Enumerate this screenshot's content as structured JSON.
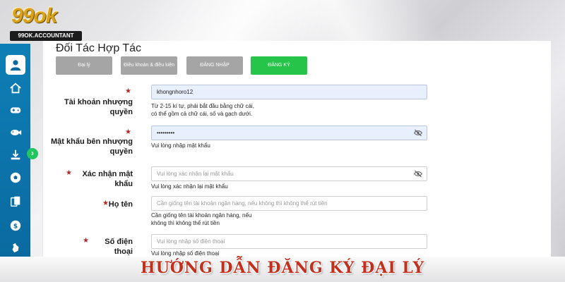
{
  "logo": {
    "number": "99ok",
    "domain": "99OK.ACCOUNTANT"
  },
  "sidebar": {
    "items": [
      {
        "icon": "user-icon",
        "active": true
      },
      {
        "icon": "home-icon"
      },
      {
        "icon": "gamepad-icon"
      },
      {
        "icon": "fish-icon"
      },
      {
        "icon": "download-icon"
      },
      {
        "icon": "soccer-ball-icon"
      },
      {
        "icon": "cards-icon"
      },
      {
        "icon": "coin-icon"
      },
      {
        "icon": "cock-icon"
      }
    ],
    "toggle": "›"
  },
  "page_title": "Đối Tác Hợp Tác",
  "tabs": [
    {
      "label": "Đại lý",
      "active": false
    },
    {
      "label": "Điều khoản & điều kiện",
      "active": false
    },
    {
      "label": "ĐĂNG NHẬP",
      "active": false
    },
    {
      "label": "ĐĂNG KÝ",
      "active": true
    }
  ],
  "form": {
    "account": {
      "label_line1": "Tài khoản nhượng",
      "label_line2": "quyền",
      "value": "khongnhoro12",
      "hint_line1": "Từ 2-15 kí tự, phải bắt đầu bằng chữ cái,",
      "hint_line2": "có thể gồm cả chữ cái, số và gạch dưới."
    },
    "password": {
      "label_line1": "Mật khẩu bên nhượng",
      "label_line2": "quyền",
      "value": "•••••••••",
      "hint": "Vui lòng nhập mật khẩu"
    },
    "confirm": {
      "label": "Xác nhận mật khẩu",
      "placeholder": "Vui lòng xác nhận lại mật khẩu",
      "hint": "Vui lòng xác nhận lại mật khẩu"
    },
    "fullname": {
      "label": "Họ tên",
      "placeholder": "Cần giống tên tài khoản ngân hàng, nếu không thì không thể rút tiền",
      "hint_line1": "Cần giống tên tài khoản ngân hàng, nếu",
      "hint_line2": "không thì không thể rút tiền"
    },
    "phone": {
      "label": "Số điện thoại",
      "placeholder": "Vui lòng nhập số điện thoại",
      "hint": "Vui lòng nhập số điện thoại"
    }
  },
  "banner": {
    "text": "HƯỚNG DẪN ĐĂNG KÝ ĐẠI LÝ"
  },
  "colors": {
    "sidebar": "#0a6aa0",
    "register_tab": "#27c44a",
    "inactive_tab": "#a5a5a5",
    "banner_text": "#c2301e",
    "required_star": "#b3262a"
  }
}
